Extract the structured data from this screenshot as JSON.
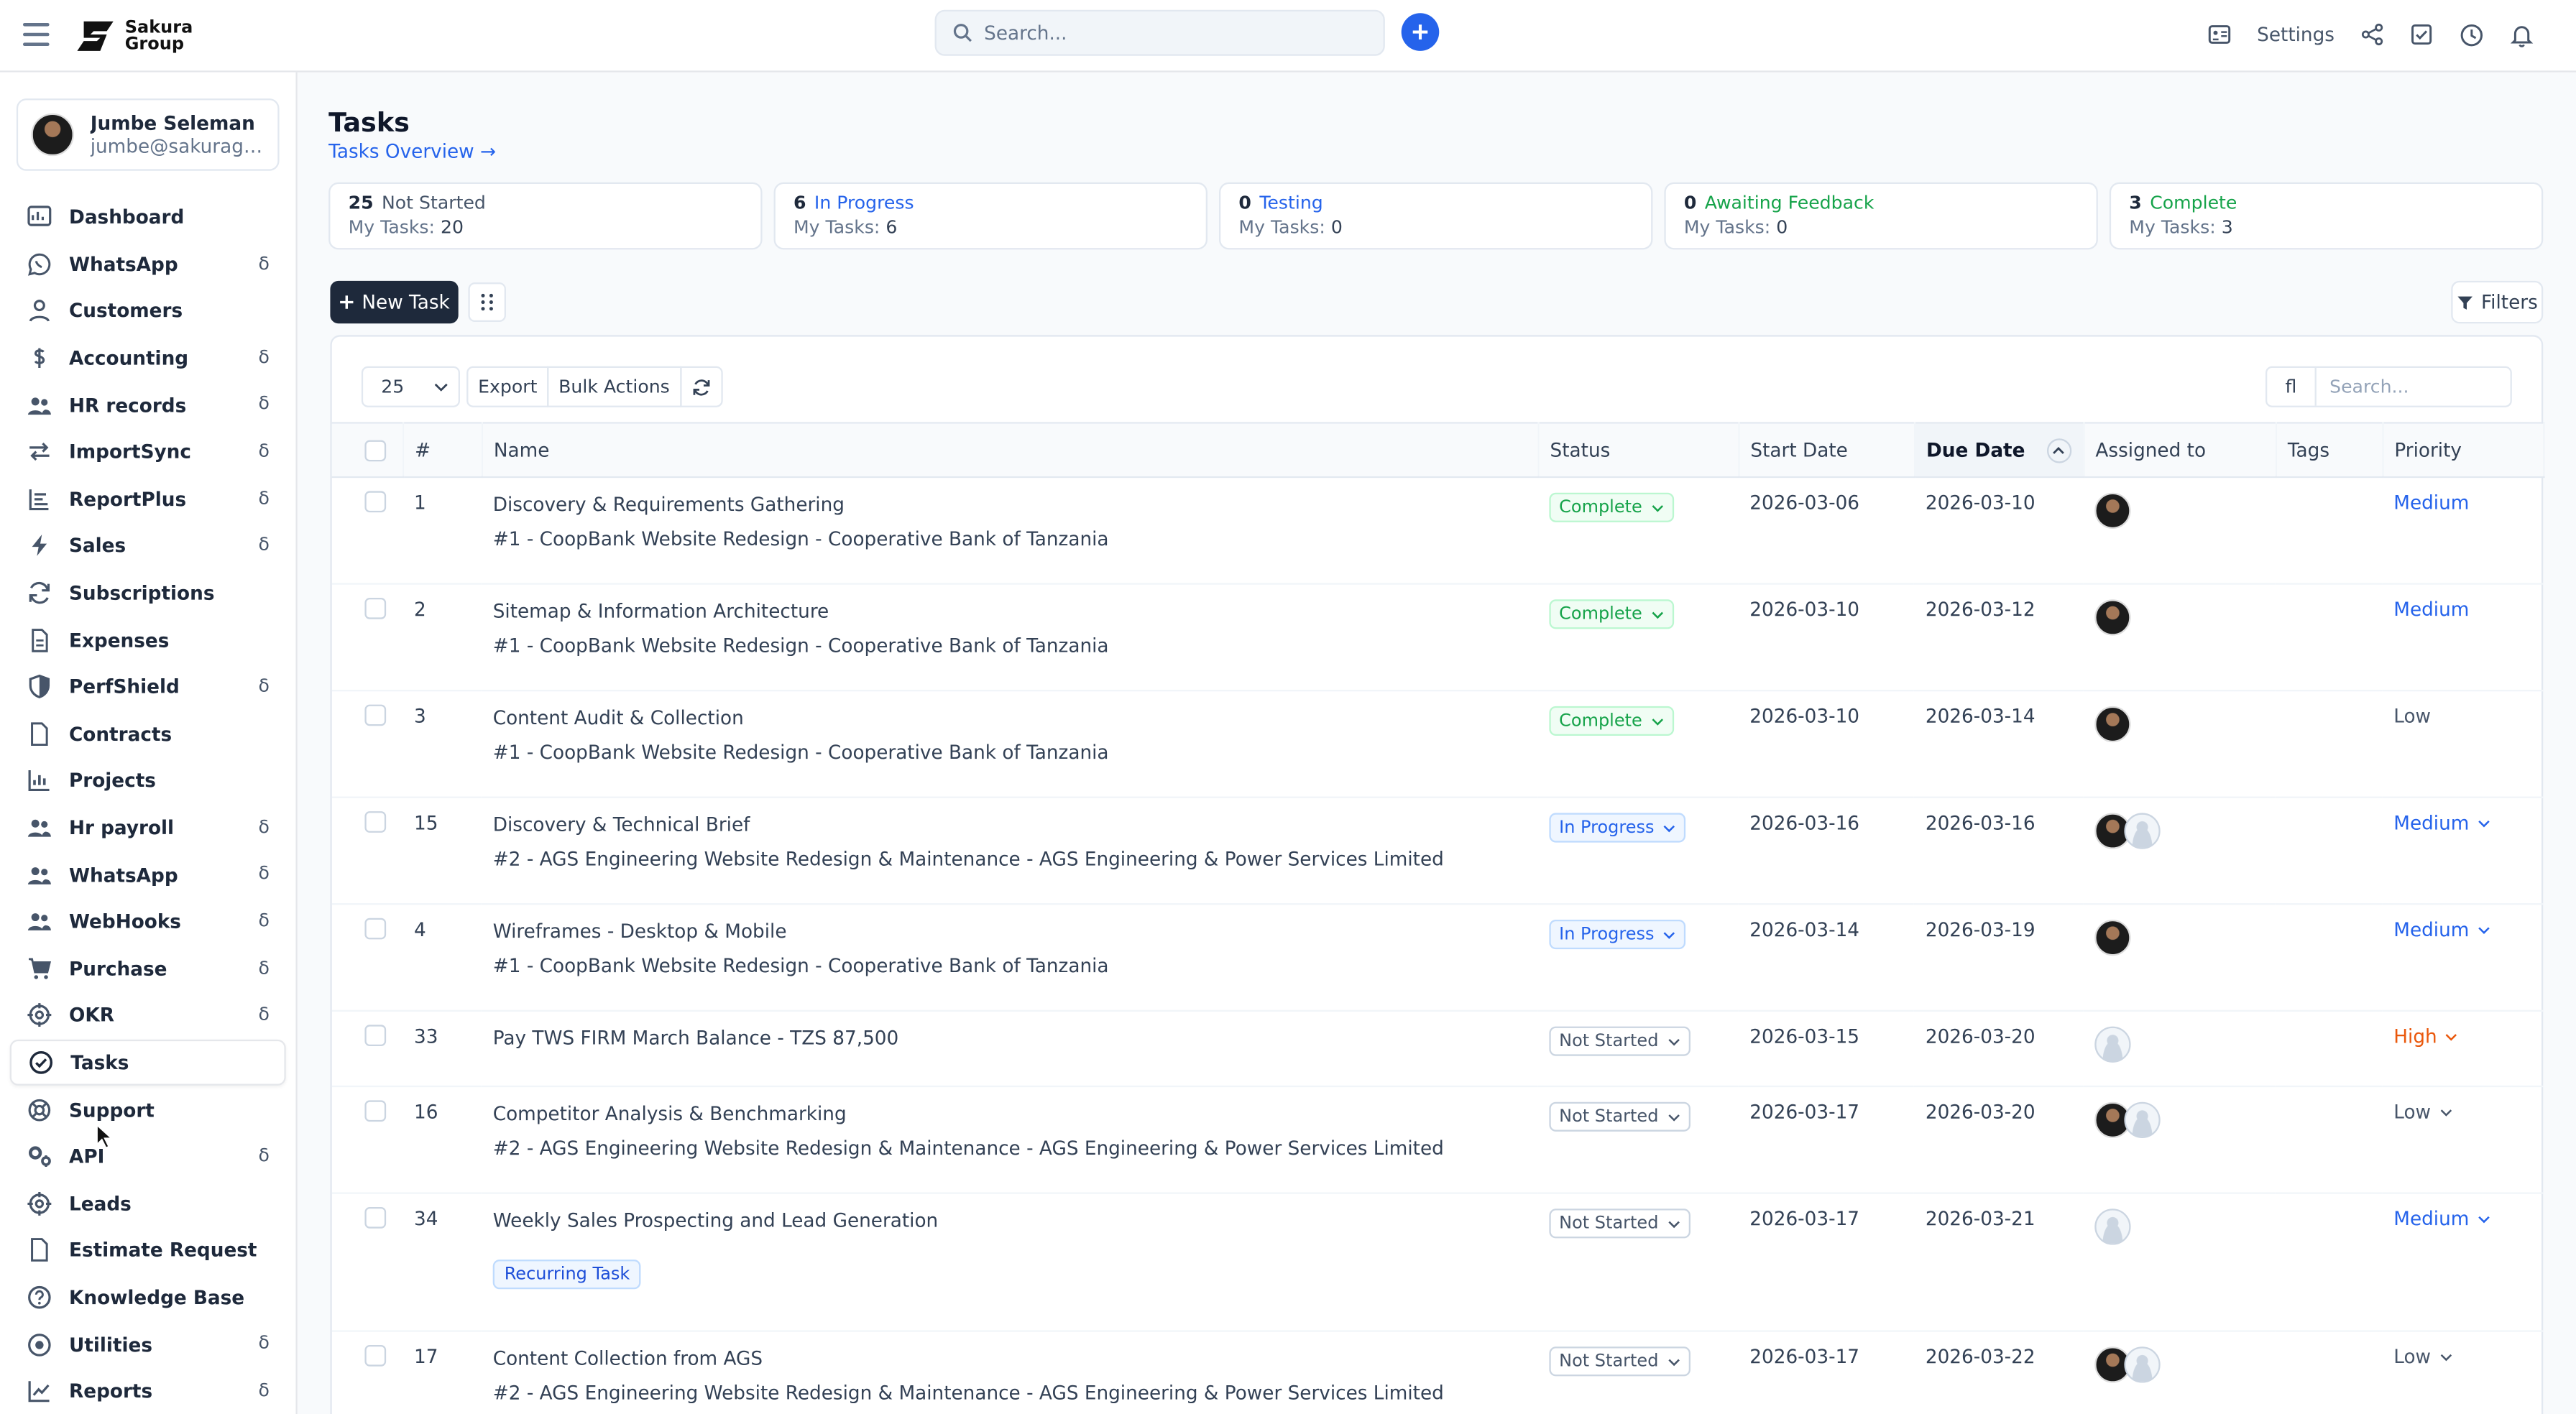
{
  "app": {
    "logo_line1": "Sakura",
    "logo_line2": "Group",
    "search_placeholder": "Search...",
    "settings_label": "Settings"
  },
  "user": {
    "name": "Jumbe Seleman",
    "email": "jumbe@sakuragroup.co.tz"
  },
  "sidebar": {
    "items": [
      {
        "label": "Dashboard",
        "icon": "dashboard-icon",
        "badge": ""
      },
      {
        "label": "WhatsApp",
        "icon": "whatsapp-icon",
        "badge": "δ"
      },
      {
        "label": "Customers",
        "icon": "user-icon",
        "badge": ""
      },
      {
        "label": "Accounting",
        "icon": "dollar-icon",
        "badge": "δ"
      },
      {
        "label": "HR records",
        "icon": "users-icon",
        "badge": "δ"
      },
      {
        "label": "ImportSync",
        "icon": "sync-arrows-icon",
        "badge": "δ"
      },
      {
        "label": "ReportPlus",
        "icon": "report-icon",
        "badge": "δ"
      },
      {
        "label": "Sales",
        "icon": "bolt-icon",
        "badge": "δ"
      },
      {
        "label": "Subscriptions",
        "icon": "refresh-icon",
        "badge": ""
      },
      {
        "label": "Expenses",
        "icon": "file-icon",
        "badge": ""
      },
      {
        "label": "PerfShield",
        "icon": "shield-icon",
        "badge": "δ"
      },
      {
        "label": "Contracts",
        "icon": "document-icon",
        "badge": ""
      },
      {
        "label": "Projects",
        "icon": "chart-bars-icon",
        "badge": ""
      },
      {
        "label": "Hr payroll",
        "icon": "users-icon",
        "badge": "δ"
      },
      {
        "label": "WhatsApp",
        "icon": "users-icon",
        "badge": "δ"
      },
      {
        "label": "WebHooks",
        "icon": "users-icon",
        "badge": "δ"
      },
      {
        "label": "Purchase",
        "icon": "cart-icon",
        "badge": "δ"
      },
      {
        "label": "OKR",
        "icon": "target-icon",
        "badge": "δ"
      },
      {
        "label": "Tasks",
        "icon": "check-circle-icon",
        "badge": "",
        "active": true
      },
      {
        "label": "Support",
        "icon": "lifebuoy-icon",
        "badge": ""
      },
      {
        "label": "API",
        "icon": "gears-icon",
        "badge": "δ"
      },
      {
        "label": "Leads",
        "icon": "target-icon",
        "badge": ""
      },
      {
        "label": "Estimate Request",
        "icon": "document-icon",
        "badge": ""
      },
      {
        "label": "Knowledge Base",
        "icon": "question-icon",
        "badge": ""
      },
      {
        "label": "Utilities",
        "icon": "dot-circle-icon",
        "badge": "δ"
      },
      {
        "label": "Reports",
        "icon": "line-chart-icon",
        "badge": "δ"
      }
    ]
  },
  "page": {
    "title": "Tasks",
    "overview_link": "Tasks Overview →"
  },
  "stats": [
    {
      "count": "25",
      "label": "Not Started",
      "my": "20",
      "color": "#475569"
    },
    {
      "count": "6",
      "label": "In Progress",
      "my": "6",
      "color": "#2563eb"
    },
    {
      "count": "0",
      "label": "Testing",
      "my": "0",
      "color": "#2563eb"
    },
    {
      "count": "0",
      "label": "Awaiting Feedback",
      "my": "0",
      "color": "#16a34a"
    },
    {
      "count": "3",
      "label": "Complete",
      "my": "3",
      "color": "#16a34a"
    }
  ],
  "stats_my_label": "My Tasks:",
  "toolbar": {
    "new_task": "New Task",
    "filters": "Filters",
    "page_size": "25",
    "export": "Export",
    "bulk_actions": "Bulk Actions",
    "search_placeholder": "Search...",
    "search_icon": "fl"
  },
  "table": {
    "columns": [
      "#",
      "Name",
      "Status",
      "Start Date",
      "Due Date",
      "Assigned to",
      "Tags",
      "Priority"
    ],
    "rows": [
      {
        "id": "1",
        "name": "Discovery & Requirements Gathering",
        "project": "#1 - CoopBank Website Redesign - Cooperative Bank of Tanzania",
        "status": "Complete",
        "start": "2026-03-06",
        "due": "2026-03-10",
        "assignees": [
          "photo"
        ],
        "priority": "Medium",
        "prio_menu": false,
        "tag": ""
      },
      {
        "id": "2",
        "name": "Sitemap & Information Architecture",
        "project": "#1 - CoopBank Website Redesign - Cooperative Bank of Tanzania",
        "status": "Complete",
        "start": "2026-03-10",
        "due": "2026-03-12",
        "assignees": [
          "photo"
        ],
        "priority": "Medium",
        "prio_menu": false,
        "tag": ""
      },
      {
        "id": "3",
        "name": "Content Audit & Collection",
        "project": "#1 - CoopBank Website Redesign - Cooperative Bank of Tanzania",
        "status": "Complete",
        "start": "2026-03-10",
        "due": "2026-03-14",
        "assignees": [
          "photo"
        ],
        "priority": "Low",
        "prio_menu": false,
        "tag": ""
      },
      {
        "id": "15",
        "name": "Discovery & Technical Brief",
        "project": "#2 - AGS Engineering Website Redesign & Maintenance - AGS Engineering & Power Services Limited",
        "status": "In Progress",
        "start": "2026-03-16",
        "due": "2026-03-16",
        "assignees": [
          "photo",
          "empty"
        ],
        "priority": "Medium",
        "prio_menu": true,
        "tag": ""
      },
      {
        "id": "4",
        "name": "Wireframes - Desktop & Mobile",
        "project": "#1 - CoopBank Website Redesign - Cooperative Bank of Tanzania",
        "status": "In Progress",
        "start": "2026-03-14",
        "due": "2026-03-19",
        "assignees": [
          "photo"
        ],
        "priority": "Medium",
        "prio_menu": true,
        "tag": ""
      },
      {
        "id": "33",
        "name": "Pay TWS FIRM March Balance - TZS 87,500",
        "project": "",
        "status": "Not Started",
        "start": "2026-03-15",
        "due": "2026-03-20",
        "assignees": [
          "empty"
        ],
        "priority": "High",
        "prio_menu": true,
        "tag": ""
      },
      {
        "id": "16",
        "name": "Competitor Analysis & Benchmarking",
        "project": "#2 - AGS Engineering Website Redesign & Maintenance - AGS Engineering & Power Services Limited",
        "status": "Not Started",
        "start": "2026-03-17",
        "due": "2026-03-20",
        "assignees": [
          "photo",
          "empty"
        ],
        "priority": "Low",
        "prio_menu": true,
        "tag": ""
      },
      {
        "id": "34",
        "name": "Weekly Sales Prospecting and Lead Generation",
        "project": "",
        "status": "Not Started",
        "start": "2026-03-17",
        "due": "2026-03-21",
        "assignees": [
          "empty"
        ],
        "priority": "Medium",
        "prio_menu": true,
        "tag": "Recurring Task"
      },
      {
        "id": "17",
        "name": "Content Collection from AGS",
        "project": "#2 - AGS Engineering Website Redesign & Maintenance - AGS Engineering & Power Services Limited",
        "status": "Not Started",
        "start": "2026-03-17",
        "due": "2026-03-22",
        "assignees": [
          "photo",
          "empty"
        ],
        "priority": "Low",
        "prio_menu": true,
        "tag": ""
      }
    ]
  }
}
